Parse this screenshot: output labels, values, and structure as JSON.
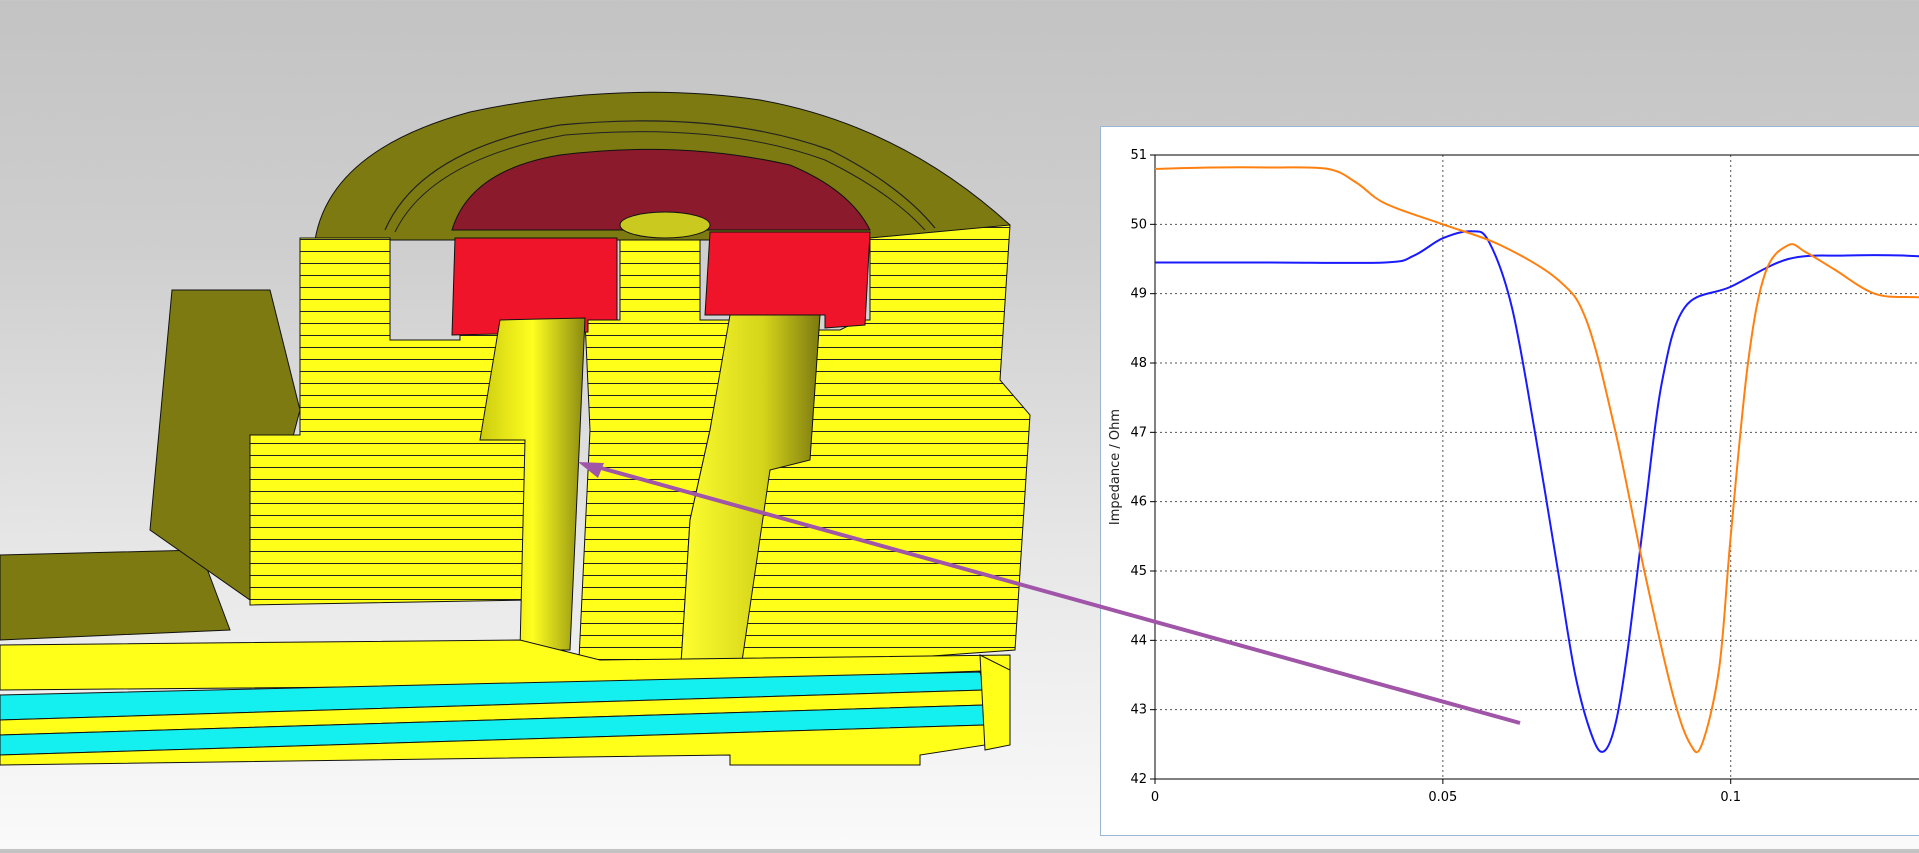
{
  "colors": {
    "bg_top": "#c3c3c3",
    "bg_bottom": "#fafafa",
    "olive": "#7c7a10",
    "olive_dark": "#5e5c0a",
    "yellow": "#ffff1a",
    "yellow_shade": "#d8d81a",
    "red": "#f0142a",
    "maroon": "#8a1a2c",
    "cyan": "#14f0f0",
    "arrow": "#a055a8",
    "series_blue": "#1a1aff",
    "series_orange": "#ff8010"
  },
  "model_view": {
    "description_icon": "3d-coax-connector-cross-section-model"
  },
  "chart_data": {
    "type": "line",
    "ylabel": "Impedance / Ohm",
    "xlabel": "",
    "xlim": [
      0,
      0.14
    ],
    "ylim": [
      42,
      51
    ],
    "x_ticks": [
      "0",
      "0.05",
      "0.1"
    ],
    "y_ticks": [
      "51",
      "50",
      "49",
      "48",
      "47",
      "46",
      "45",
      "44",
      "43",
      "42"
    ],
    "grid": true,
    "series": [
      {
        "color": "#1a1aff",
        "x": [
          0,
          0.02,
          0.04,
          0.045,
          0.05,
          0.055,
          0.058,
          0.062,
          0.066,
          0.07,
          0.073,
          0.076,
          0.078,
          0.08,
          0.082,
          0.085,
          0.088,
          0.092,
          0.1,
          0.11,
          0.12,
          0.13,
          0.14
        ],
        "y": [
          49.45,
          49.45,
          49.45,
          49.55,
          49.8,
          49.9,
          49.75,
          48.8,
          47.0,
          45.0,
          43.5,
          42.6,
          42.4,
          42.8,
          43.8,
          45.8,
          47.7,
          48.8,
          49.1,
          49.5,
          49.55,
          49.55,
          49.5
        ]
      },
      {
        "color": "#ff8010",
        "x": [
          0,
          0.01,
          0.02,
          0.03,
          0.035,
          0.04,
          0.05,
          0.06,
          0.07,
          0.075,
          0.08,
          0.085,
          0.09,
          0.093,
          0.095,
          0.098,
          0.1,
          0.103,
          0.106,
          0.11,
          0.113,
          0.118,
          0.125,
          0.132,
          0.14
        ],
        "y": [
          50.8,
          50.82,
          50.82,
          50.8,
          50.6,
          50.3,
          50.0,
          49.7,
          49.2,
          48.6,
          47.0,
          45.0,
          43.2,
          42.5,
          42.5,
          43.6,
          45.5,
          48.0,
          49.3,
          49.7,
          49.6,
          49.35,
          49.0,
          48.95,
          48.95
        ]
      }
    ]
  }
}
